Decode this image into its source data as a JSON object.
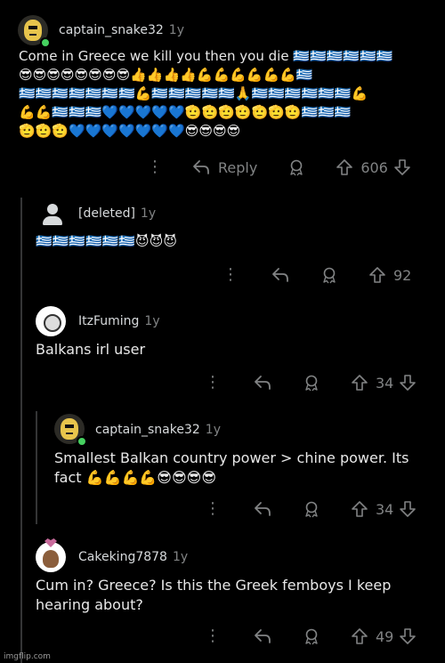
{
  "comments": [
    {
      "username": "captain_snake32",
      "age": "1y",
      "text": "Come in Greece we kill you then you die 🇬🇷🇬🇷🇬🇷🇬🇷🇬🇷🇬🇷\n😎😎😎😎😎😎😎😎👍👍👍👍💪💪💪💪💪💪🇬🇷\n🇬🇷🇬🇷🇬🇷🇬🇷🇬🇷🇬🇷🇬🇷💪🇬🇷🇬🇷🇬🇷🇬🇷🇬🇷🙏🇬🇷🇬🇷🇬🇷🇬🇷🇬🇷🇬🇷💪\n💪💪🇬🇷🇬🇷🇬🇷💙💙💙💙💙🫡🫡🫡🫡🫡🫡🫡🇬🇷🇬🇷🇬🇷\n🫡🫡🫡💙💙💙💙💙💙💙😎😎😎😎",
      "reply_label": "Reply",
      "score": "606"
    },
    {
      "username": "[deleted]",
      "age": "1y",
      "text": "🇬🇷🇬🇷🇬🇷🇬🇷🇬🇷🇬🇷😈😈😈",
      "score": "92"
    },
    {
      "username": "ItzFuming",
      "age": "1y",
      "text": "Balkans irl user",
      "score": "34"
    },
    {
      "username": "captain_snake32",
      "age": "1y",
      "text": "Smallest Balkan country power > chine power. Its\nfact 💪💪💪💪😎😎😎😎",
      "score": "34"
    },
    {
      "username": "Cakeking7878",
      "age": "1y",
      "text": "Cum in? Greece? Is this the Greek femboys I keep\nhearing about?",
      "score": "49"
    }
  ],
  "watermark": "imgflip.com"
}
